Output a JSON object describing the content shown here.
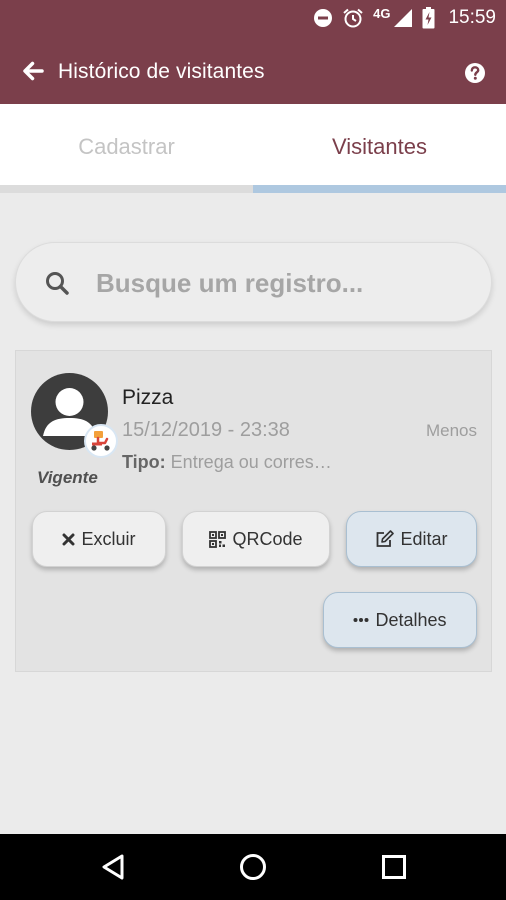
{
  "status_bar": {
    "time": "15:59",
    "network": "4G",
    "icons": [
      "do-not-disturb-icon",
      "alarm-icon",
      "signal-icon",
      "battery-charging-icon"
    ]
  },
  "app_bar": {
    "title": "Histórico de visitantes",
    "back_icon": "arrow-left-icon",
    "help_icon": "question-circle-icon",
    "color": "#7b3f4b"
  },
  "tabs": [
    {
      "label": "Cadastrar",
      "active": false
    },
    {
      "label": "Visitantes",
      "active": true
    }
  ],
  "search": {
    "placeholder": "Busque um registro...",
    "value": ""
  },
  "visitor_card": {
    "name": "Pizza",
    "datetime": "15/12/2019 - 23:38",
    "toggle_label": "Menos",
    "tipo_label": "Tipo:",
    "tipo_value": "Entrega ou corres…",
    "status": "Vigente",
    "avatar_icon": "user-avatar-icon",
    "badge_icon": "delivery-scooter-icon",
    "actions": {
      "excluir": "Excluir",
      "qrcode": "QRCode",
      "editar": "Editar",
      "detalhes": "Detalhes"
    }
  },
  "nav_bar": {
    "icons": [
      "back-triangle-icon",
      "home-circle-icon",
      "recents-square-icon"
    ]
  }
}
